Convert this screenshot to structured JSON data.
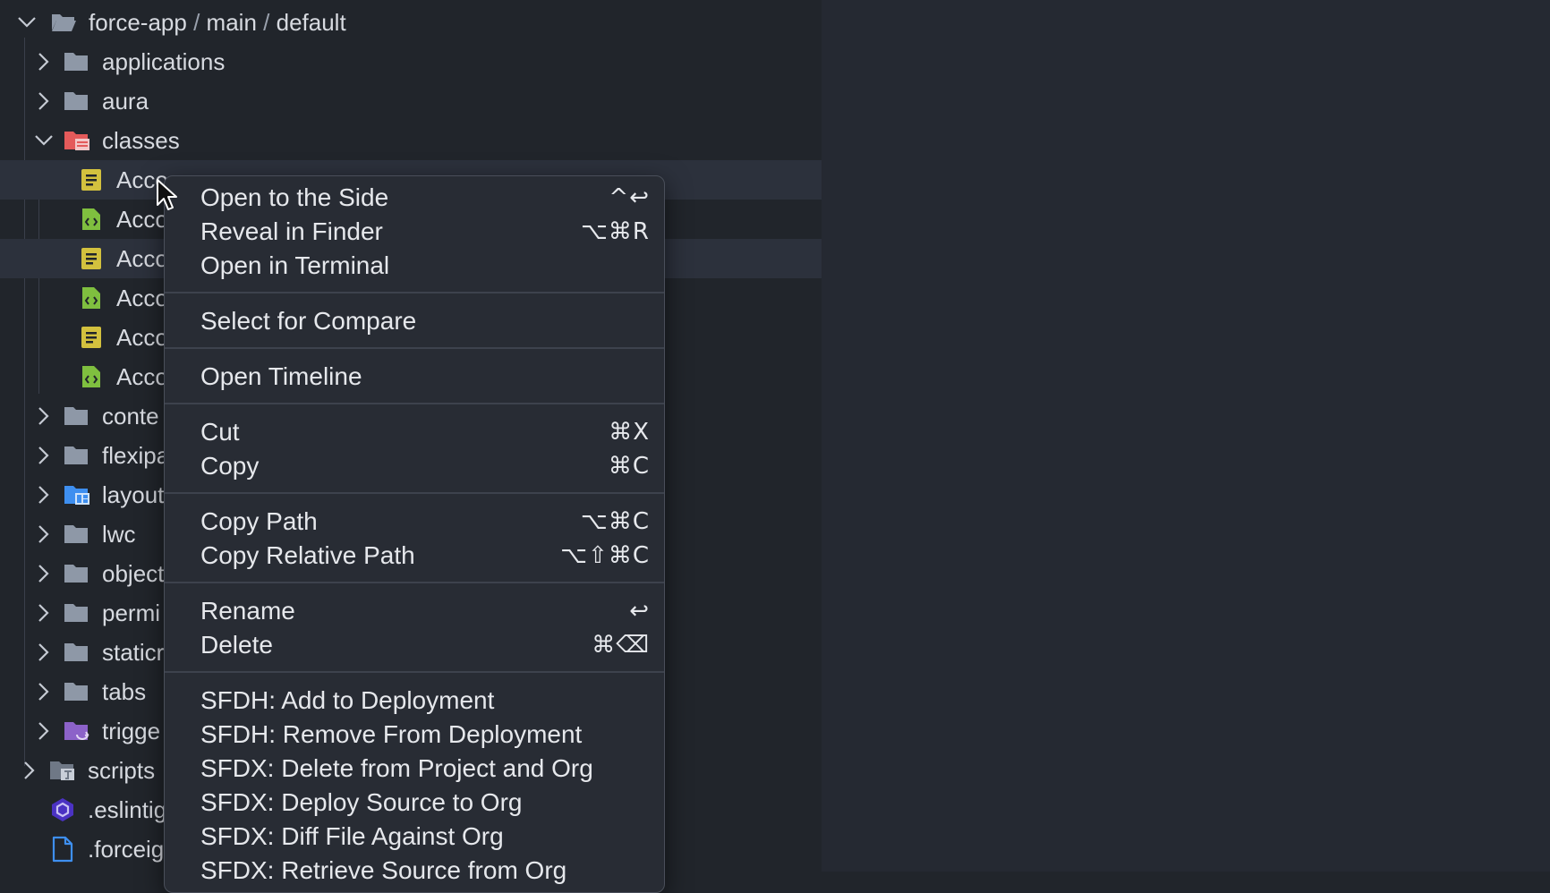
{
  "explorer": {
    "root": {
      "parts": [
        "force-app",
        "main",
        "default"
      ],
      "separator": "/"
    },
    "folders_top": [
      {
        "label": "applications"
      },
      {
        "label": "aura"
      },
      {
        "label": "classes"
      }
    ],
    "class_files": [
      {
        "label": "Acco",
        "icon": "apex-class-icon"
      },
      {
        "label": "Acco",
        "icon": "apex-meta-xml-icon"
      },
      {
        "label": "Acco",
        "icon": "apex-class-icon"
      },
      {
        "label": "Acco",
        "icon": "apex-meta-xml-icon"
      },
      {
        "label": "Acco",
        "icon": "apex-class-icon"
      },
      {
        "label": "Acco",
        "icon": "apex-meta-xml-icon"
      }
    ],
    "folders_bottom": [
      {
        "label": "conte"
      },
      {
        "label": "flexipa"
      },
      {
        "label": "layout"
      },
      {
        "label": "lwc"
      },
      {
        "label": "object"
      },
      {
        "label": "permi"
      },
      {
        "label": "staticr"
      },
      {
        "label": "tabs"
      },
      {
        "label": "trigge"
      }
    ],
    "root_items": [
      {
        "label": "scripts"
      },
      {
        "label": ".eslintig"
      },
      {
        "label": ".forceig"
      }
    ]
  },
  "context_menu": {
    "items": [
      {
        "label": "Open to the Side",
        "shortcut": "^↩"
      },
      {
        "label": "Reveal in Finder",
        "shortcut": "⌥⌘R"
      },
      {
        "label": "Open in Terminal",
        "shortcut": ""
      },
      {
        "label": "Select for Compare",
        "shortcut": ""
      },
      {
        "label": "Open Timeline",
        "shortcut": ""
      },
      {
        "label": "Cut",
        "shortcut": "⌘X"
      },
      {
        "label": "Copy",
        "shortcut": "⌘C"
      },
      {
        "label": "Copy Path",
        "shortcut": "⌥⌘C"
      },
      {
        "label": "Copy Relative Path",
        "shortcut": "⌥⇧⌘C"
      },
      {
        "label": "Rename",
        "shortcut": "↩"
      },
      {
        "label": "Delete",
        "shortcut": "⌘⌫"
      },
      {
        "label": "SFDH: Add to Deployment",
        "shortcut": ""
      },
      {
        "label": "SFDH: Remove From Deployment",
        "shortcut": ""
      },
      {
        "label": "SFDX: Delete from Project and Org",
        "shortcut": ""
      },
      {
        "label": "SFDX: Deploy Source to Org",
        "shortcut": ""
      },
      {
        "label": "SFDX: Diff File Against Org",
        "shortcut": ""
      },
      {
        "label": "SFDX: Retrieve Source from Org",
        "shortcut": ""
      }
    ]
  },
  "colors": {
    "background": "#21252b",
    "folder": "#8e98a7",
    "classes_folder": "#e45a5a",
    "apex_class": "#d3c13e",
    "apex_meta": "#7fbf3f",
    "layout_folder": "#3e8ff0",
    "trigger_folder": "#8c62c9",
    "eslint": "#4b32c3",
    "file_outline": "#3e8ff0"
  }
}
